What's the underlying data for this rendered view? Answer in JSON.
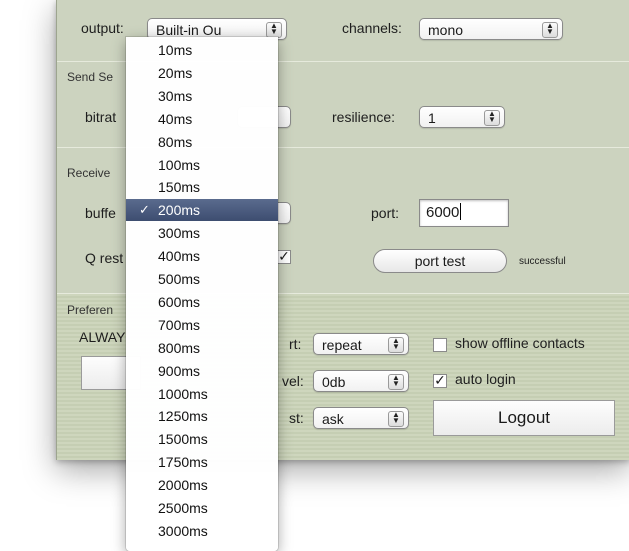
{
  "audio": {
    "output_label": "output:",
    "output_value": "Built-in Ou",
    "channels_label": "channels:",
    "channels_value": "mono"
  },
  "send": {
    "title": "Send Se",
    "bitrate_label": "bitrat",
    "resilience_label": "resilience:",
    "resilience_value": "1"
  },
  "receive": {
    "title": "Receive",
    "buffer_label": "buffe",
    "port_label": "port:",
    "port_value": "6000",
    "q_label": "Q rest",
    "port_test_label": "port test",
    "port_test_status": "successful"
  },
  "preferences": {
    "title": "Preferen",
    "always_label": "ALWAY",
    "alert_label": "rt:",
    "alert_value": "repeat",
    "level_label": "vel:",
    "level_value": "0db",
    "request_label": "st:",
    "request_value": "ask",
    "show_offline_label": "show offline contacts",
    "show_offline_checked": false,
    "auto_login_label": "auto login",
    "auto_login_checked": true,
    "logout_label": "Logout"
  },
  "buffer_menu": {
    "selected": "200ms",
    "items": [
      "10ms",
      "20ms",
      "30ms",
      "40ms",
      "80ms",
      "100ms",
      "150ms",
      "200ms",
      "300ms",
      "400ms",
      "500ms",
      "600ms",
      "700ms",
      "800ms",
      "900ms",
      "1000ms",
      "1250ms",
      "1500ms",
      "1750ms",
      "2000ms",
      "2500ms",
      "3000ms"
    ]
  },
  "colors": {
    "panel": "#ccd3bf",
    "selection": "#3d4d70"
  }
}
